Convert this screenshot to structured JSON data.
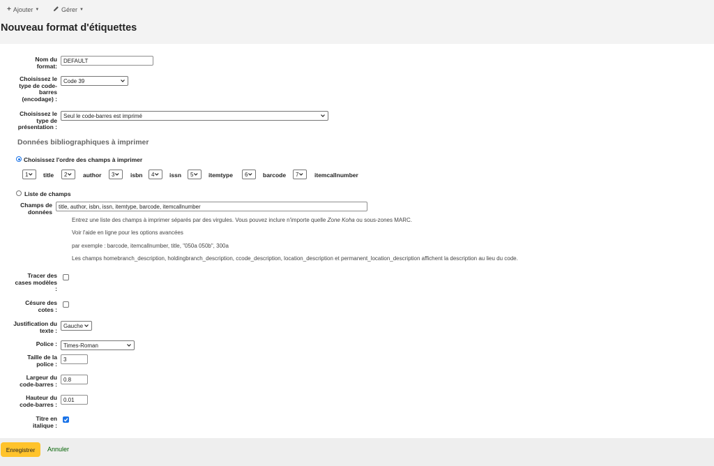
{
  "toolbar": {
    "add_label": "Ajouter",
    "manage_label": "Gérer"
  },
  "page_title": "Nouveau format d'étiquettes",
  "form": {
    "name": {
      "label": "Nom du format:",
      "value": "DEFAULT"
    },
    "barcode_type": {
      "label": "Choisissez le type de code-barres (encodage) :",
      "value": "Code 39"
    },
    "layout_type": {
      "label": "Choisissez le type de présentation :",
      "value": "Seul le code-barres est imprimé"
    },
    "section_title": "Données bibliographiques à imprimer",
    "order_option": {
      "label": "Choisissez l'ordre des champs à imprimer",
      "selected": true,
      "fields": [
        {
          "order": "1",
          "name": "title"
        },
        {
          "order": "2",
          "name": "author"
        },
        {
          "order": "3",
          "name": "isbn"
        },
        {
          "order": "4",
          "name": "issn"
        },
        {
          "order": "5",
          "name": "itemtype"
        },
        {
          "order": "6",
          "name": "barcode"
        },
        {
          "order": "7",
          "name": "itemcallnumber"
        }
      ]
    },
    "list_option": {
      "label": "Liste de champs",
      "selected": false,
      "data_fields_label": "Champs de données",
      "data_fields_value": "title, author, isbn, issn, itemtype, barcode, itemcallnumber",
      "hint1_before": "Entrez une liste des champs à imprimer séparés par des virgules. Vous pouvez inclure n'importe quelle ",
      "hint1_em": "Zone Koha",
      "hint1_after": " ou sous-zones MARC.",
      "hint2": "Voir l'aide en ligne pour les options avancées",
      "hint3": "par exemple : barcode, itemcallnumber, title, \"050a 050b\", 300a",
      "hint4": "Les champs homebranch_description, holdingbranch_description, ccode_description, location_description et permanent_location_description affichent la description au lieu du code."
    },
    "guide_boxes": {
      "label": "Tracer des cases modèles :",
      "checked": false
    },
    "callnum_split": {
      "label": "Césure des cotes :",
      "checked": false
    },
    "text_justify": {
      "label": "Justification du texte :",
      "value": "Gauche"
    },
    "font": {
      "label": "Police :",
      "value": "Times-Roman"
    },
    "font_size": {
      "label": "Taille de la police :",
      "value": "3"
    },
    "barcode_width": {
      "label": "Largeur du code-barres :",
      "value": "0.8"
    },
    "barcode_height": {
      "label": "Hauteur du code-barres :",
      "value": "0.01"
    },
    "oblique_title": {
      "label": "Titre en italique :",
      "checked": true
    }
  },
  "footer": {
    "save_label": "Enregistrer",
    "cancel_label": "Annuler"
  },
  "colors": {
    "save_button": "#ffc32b",
    "cancel_link": "#006100",
    "header_background": "#f3f3f3"
  }
}
